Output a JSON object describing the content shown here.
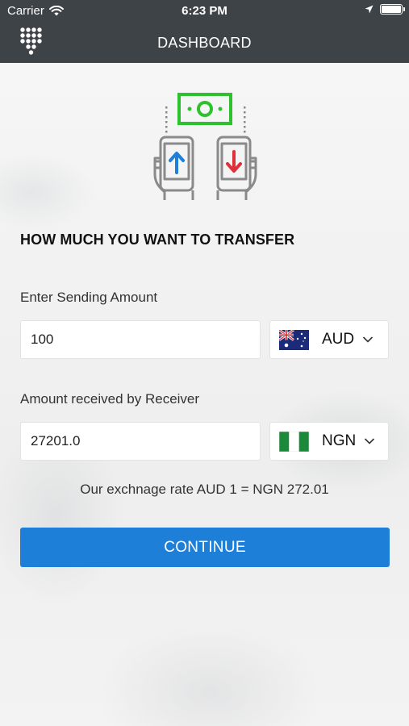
{
  "status_bar": {
    "carrier": "Carrier",
    "time": "6:23 PM"
  },
  "nav": {
    "title": "DASHBOARD",
    "menu_icon": "dial-pad-icon"
  },
  "hero_icon": "phone-transfer-illustration",
  "form": {
    "heading": "HOW MUCH YOU WANT TO TRANSFER",
    "sending": {
      "label": "Enter Sending Amount",
      "value": "100",
      "currency": "AUD",
      "flag": "australia-flag-icon"
    },
    "receiving": {
      "label": "Amount received by Receiver",
      "value": "27201.0",
      "currency": "NGN",
      "flag": "nigeria-flag-icon"
    },
    "rate_text": "Our exchnage rate AUD 1 = NGN 272.01",
    "continue_label": "CONTINUE"
  },
  "colors": {
    "bar": "#3e4347",
    "accent": "#1e7fd9",
    "money_green": "#2ec12e",
    "arrow_blue": "#1e7fd9",
    "arrow_red": "#e0303a"
  }
}
